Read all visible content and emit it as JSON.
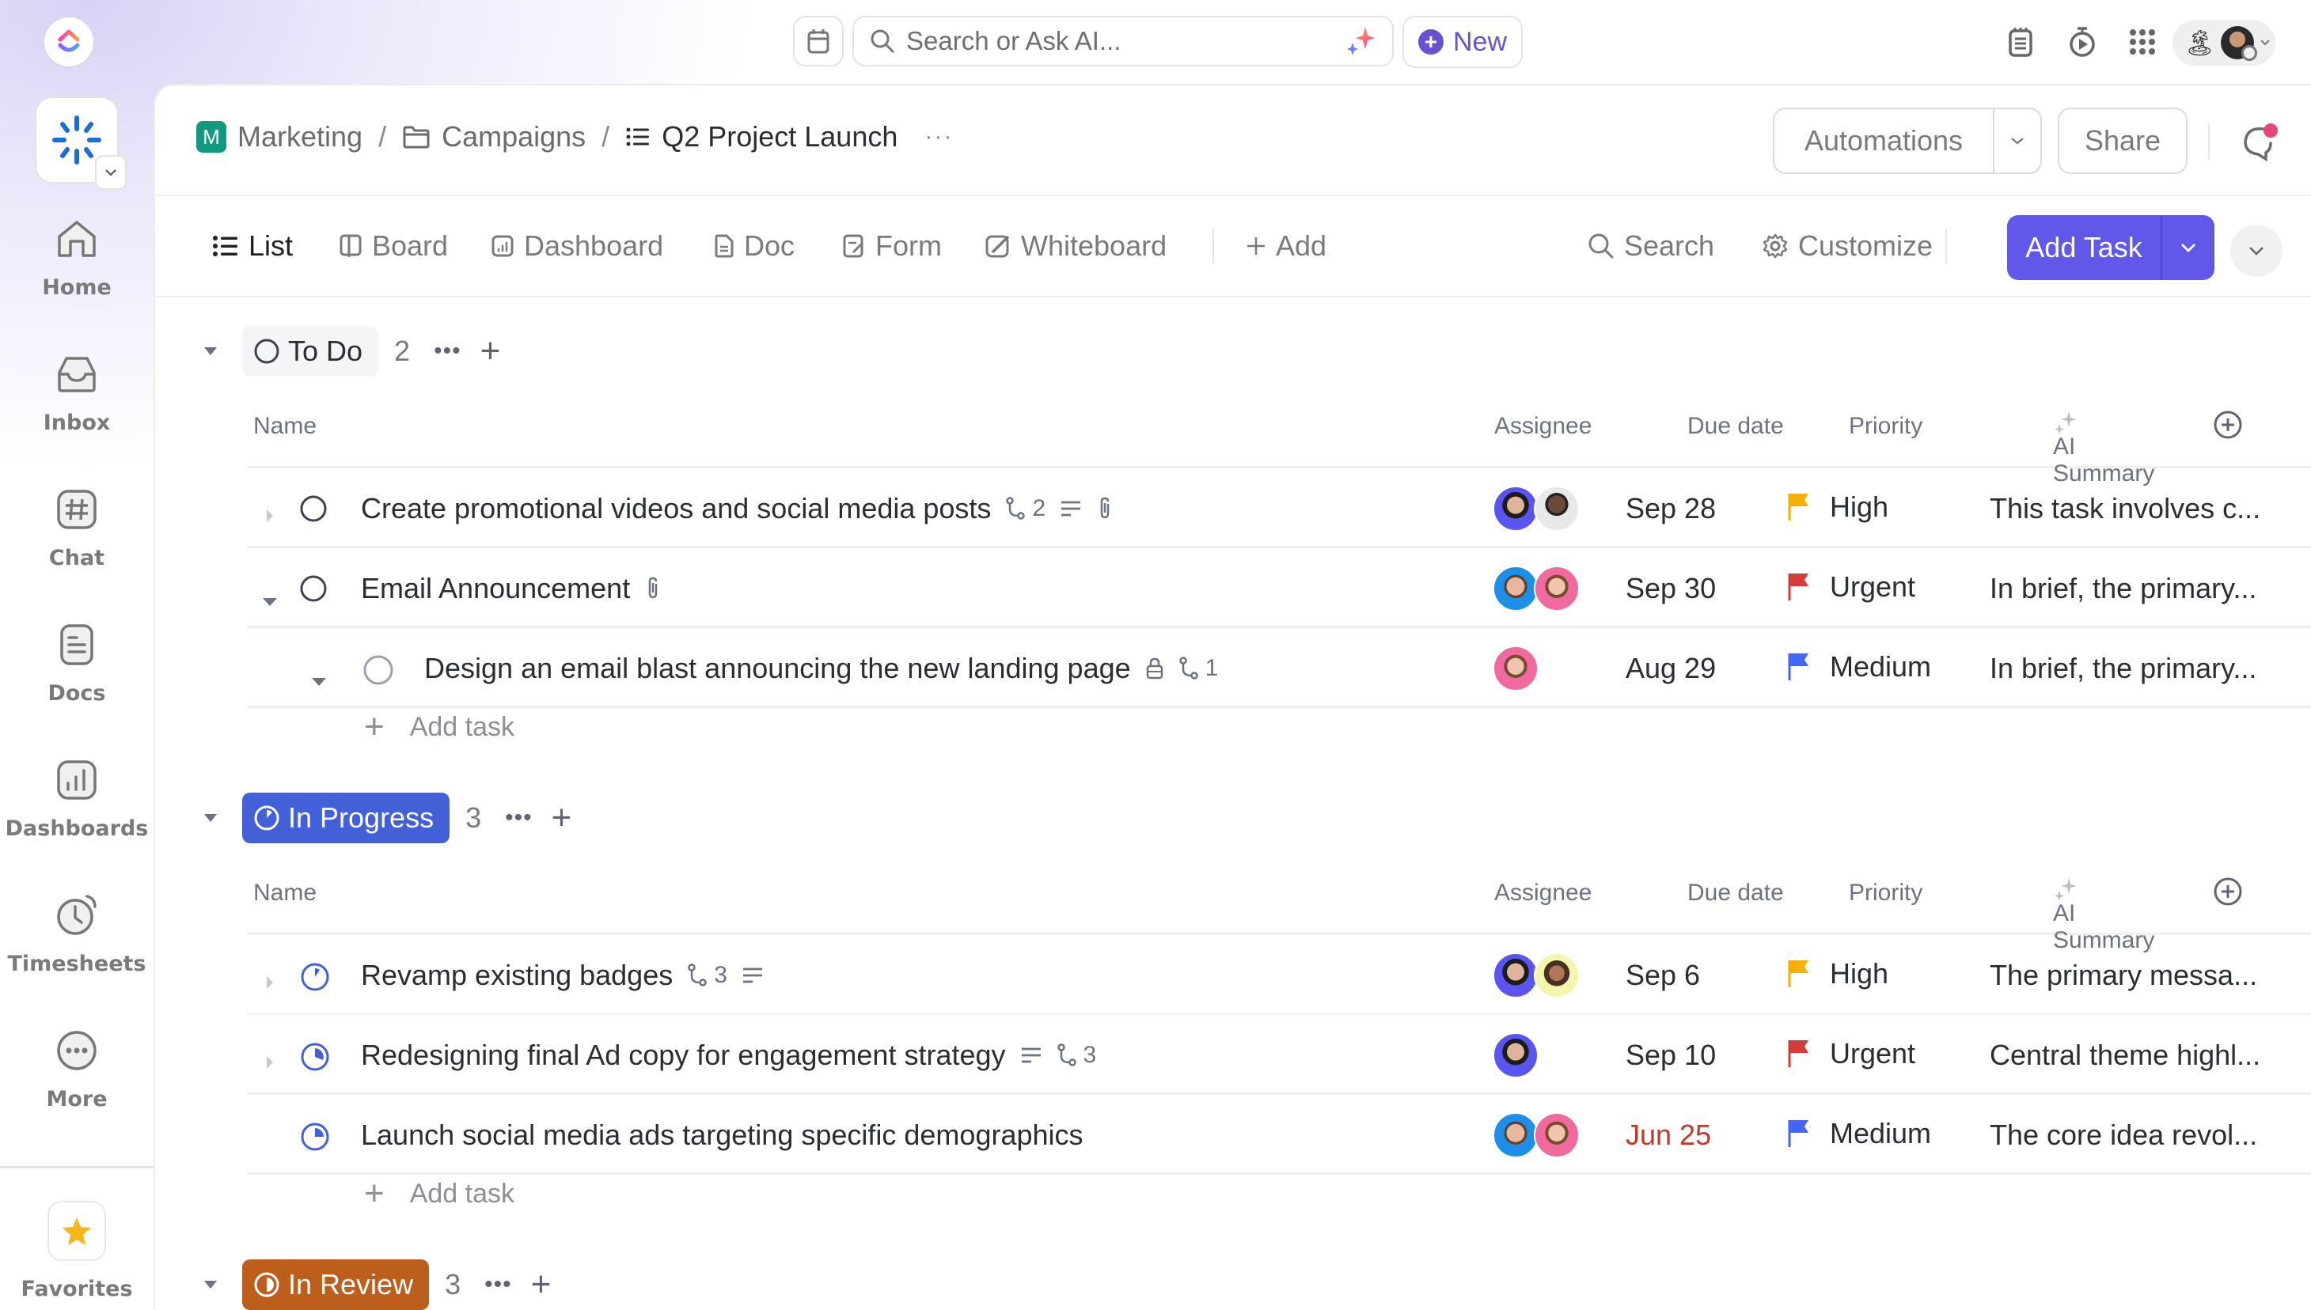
{
  "topbar": {
    "search_placeholder": "Search or Ask AI...",
    "new_label": "New",
    "icons": [
      "calendar-icon",
      "search-icon",
      "ai-sparkle-icon",
      "notepad-icon",
      "timer-icon",
      "apps-grid-icon",
      "vacation-status-icon"
    ]
  },
  "rail": {
    "items": [
      {
        "label": "Home",
        "icon": "home-icon"
      },
      {
        "label": "Inbox",
        "icon": "inbox-icon"
      },
      {
        "label": "Chat",
        "icon": "hashtag-icon"
      },
      {
        "label": "Docs",
        "icon": "doc-icon"
      },
      {
        "label": "Dashboards",
        "icon": "bar-chart-icon"
      },
      {
        "label": "Timesheets",
        "icon": "clock-icon"
      },
      {
        "label": "More",
        "icon": "more-icon"
      }
    ],
    "favorites_label": "Favorites"
  },
  "header": {
    "breadcrumb": {
      "space_initial": "M",
      "space": "Marketing",
      "folder": "Campaigns",
      "list": "Q2 Project Launch",
      "more": "···"
    },
    "automations_label": "Automations",
    "share_label": "Share",
    "colors": {
      "space_badge": "#129a7e",
      "notification_dot": "#e8457a"
    }
  },
  "views": {
    "tabs": [
      {
        "label": "List",
        "icon": "list-icon",
        "active": true
      },
      {
        "label": "Board",
        "icon": "board-icon"
      },
      {
        "label": "Dashboard",
        "icon": "dashboard-icon"
      },
      {
        "label": "Doc",
        "icon": "doc-icon"
      },
      {
        "label": "Form",
        "icon": "form-icon"
      },
      {
        "label": "Whiteboard",
        "icon": "whiteboard-icon"
      },
      {
        "label": "Add",
        "icon": "plus-icon"
      }
    ],
    "search_label": "Search",
    "customize_label": "Customize",
    "add_task_label": "Add Task",
    "accent": "#6157e8"
  },
  "columns": {
    "name": "Name",
    "assignee": "Assignee",
    "due_date": "Due date",
    "priority": "Priority",
    "ai_summary": "AI Summary"
  },
  "add_task_label": "Add task",
  "groups": [
    {
      "status": "To Do",
      "count": "2",
      "color": "#f4f5f7",
      "text_color": "#292d34",
      "tasks": [
        {
          "name": "Create promotional videos and social media posts",
          "subtasks": "2",
          "has_description": true,
          "has_attachment": true,
          "assignees": [
            "avatar-man-purple",
            "avatar-man-grey"
          ],
          "due": "Sep 28",
          "priority": "High",
          "priority_color": "#f5b000",
          "summary": "This task involves c..."
        },
        {
          "name": "Email Announcement",
          "has_attachment": true,
          "expanded": true,
          "assignees": [
            "avatar-man-blue",
            "avatar-woman-pink"
          ],
          "due": "Sep 30",
          "priority": "Urgent",
          "priority_color": "#d63b3b",
          "summary": "In brief, the primary..."
        },
        {
          "name": "Design an email blast announcing the new landing page",
          "subtask_of": "Email Announcement",
          "locked": true,
          "subtasks": "1",
          "assignees": [
            "avatar-woman-pink"
          ],
          "due": "Aug 29",
          "priority": "Medium",
          "priority_color": "#4466f5",
          "summary": "In brief, the primary..."
        }
      ]
    },
    {
      "status": "In Progress",
      "count": "3",
      "color": "#4360d8",
      "text_color": "#ffffff",
      "tasks": [
        {
          "name": "Revamp existing badges",
          "subtasks": "3",
          "has_description": true,
          "assignees": [
            "avatar-man-purple",
            "avatar-woman-yellow"
          ],
          "due": "Sep 6",
          "priority": "High",
          "priority_color": "#f5b000",
          "summary": "The primary messa..."
        },
        {
          "name": "Redesigning final Ad copy for engagement strategy",
          "has_description": true,
          "subtasks": "3",
          "assignees": [
            "avatar-man-purple"
          ],
          "due": "Sep 10",
          "priority": "Urgent",
          "priority_color": "#d63b3b",
          "summary": "Central theme highl..."
        },
        {
          "name": "Launch social media ads targeting specific demographics",
          "assignees": [
            "avatar-man-blue",
            "avatar-woman-pink"
          ],
          "due": "Jun 25",
          "due_overdue": true,
          "due_color": "#c0392b",
          "priority": "Medium",
          "priority_color": "#4466f5",
          "summary": "The core idea revol..."
        }
      ]
    },
    {
      "status": "In Review",
      "count": "3",
      "color": "#bd5e1d",
      "text_color": "#ffffff",
      "tasks": []
    }
  ]
}
